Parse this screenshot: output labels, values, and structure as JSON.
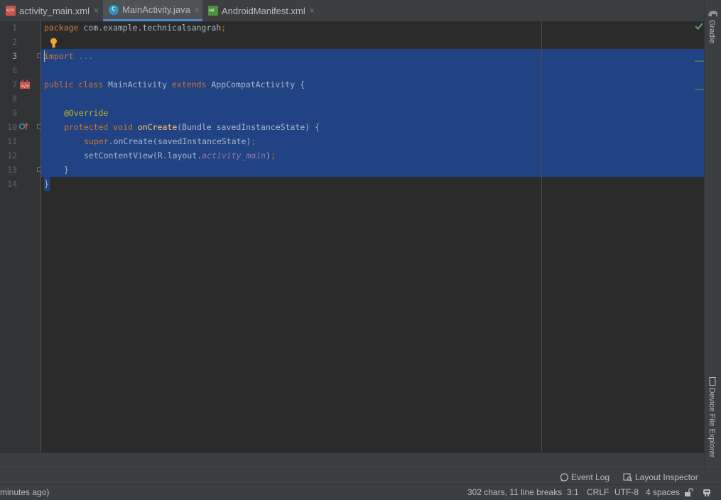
{
  "tabs": [
    {
      "label": "activity_main.xml",
      "icon": "xml-layout-icon",
      "active": false
    },
    {
      "label": "MainActivity.java",
      "icon": "java-class-icon",
      "active": true
    },
    {
      "label": "AndroidManifest.xml",
      "icon": "manifest-icon",
      "active": false
    }
  ],
  "tab_close": "×",
  "editor": {
    "line_numbers": [
      "1",
      "2",
      "3",
      "6",
      "7",
      "8",
      "9",
      "10",
      "11",
      "12",
      "13",
      "14"
    ],
    "current_line": "3",
    "lines": {
      "l1_kw": "package",
      "l1_rest": " com.example.technicalsangrah",
      "l1_semi": ";",
      "l3_kw": "import",
      "l3_fold": " ...",
      "l7_kw1": "public class",
      "l7_name": " MainActivity ",
      "l7_kw2": "extends",
      "l7_rest": " AppCompatActivity {",
      "l9_ann": "@Override",
      "l10_kw": "protected void",
      "l10_fn": " onCreate",
      "l10_rest": "(Bundle savedInstanceState) {",
      "l11_kw": "super",
      "l11_rest": ".onCreate(savedInstanceState)",
      "l11_semi": ";",
      "l12_rest": "setContentView(R.layout.",
      "l12_it": "activity_main",
      "l12_end": ")",
      "l12_semi": ";",
      "l13": "}",
      "l14": "}"
    }
  },
  "right_panel": {
    "gradle": "Gradle",
    "device_file_explorer": "Device File Explorer"
  },
  "tool_windows": {
    "event_log": "Event Log",
    "layout_inspector": "Layout Inspector"
  },
  "status": {
    "left_message": "minutes ago)",
    "chars": "302 chars, 11 line breaks",
    "position": "3:1",
    "line_sep": "CRLF",
    "encoding": "UTF-8",
    "indent": "4 spaces"
  },
  "colors": {
    "selection": "#214283",
    "keyword": "#cc7832",
    "annotation": "#bbb529",
    "method": "#ffc66d",
    "italic_field": "#9876aa"
  }
}
